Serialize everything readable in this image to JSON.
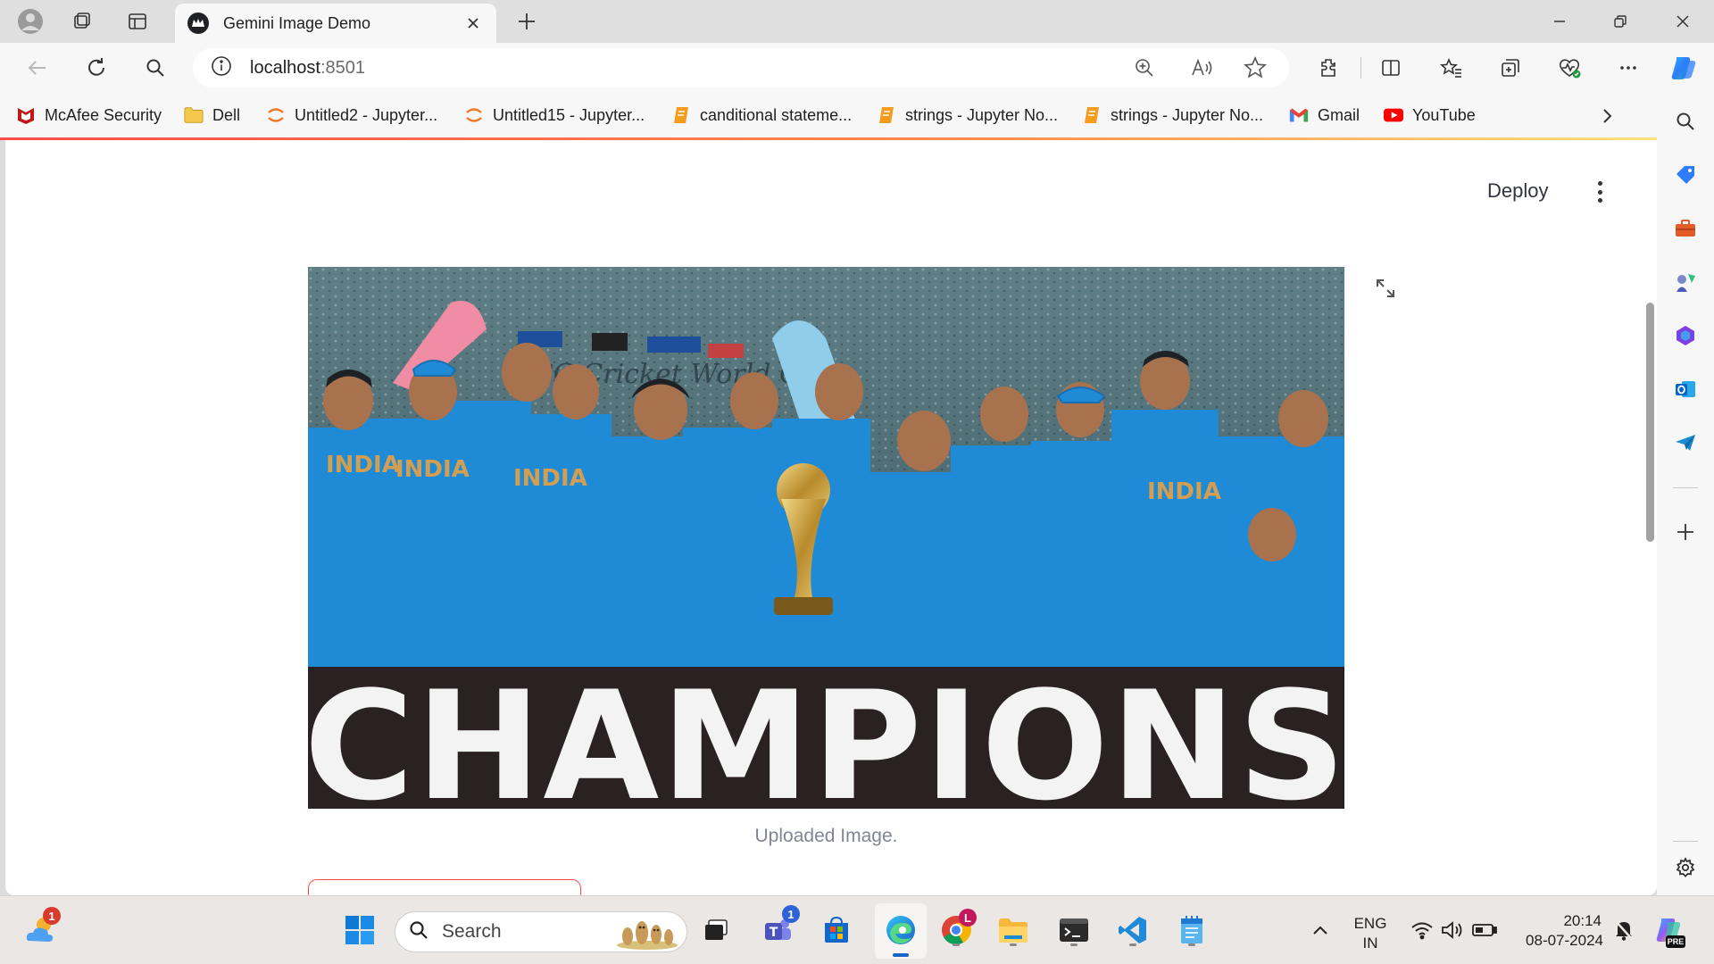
{
  "browser": {
    "tab": {
      "title": "Gemini Image Demo"
    },
    "address": {
      "host": "localhost",
      "port": ":8501"
    },
    "bookmarks": [
      {
        "label": "McAfee Security",
        "icon": "mcafee-icon"
      },
      {
        "label": "Dell",
        "icon": "folder-icon"
      },
      {
        "label": "Untitled2 - Jupyter...",
        "icon": "jupyter-icon"
      },
      {
        "label": "Untitled15 - Jupyter...",
        "icon": "jupyter-icon"
      },
      {
        "label": "canditional stateme...",
        "icon": "notebook-icon"
      },
      {
        "label": "strings - Jupyter No...",
        "icon": "notebook-icon"
      },
      {
        "label": "strings - Jupyter No...",
        "icon": "notebook-icon"
      },
      {
        "label": "Gmail",
        "icon": "gmail-icon"
      },
      {
        "label": "YouTube",
        "icon": "youtube-icon"
      }
    ]
  },
  "app": {
    "deploy_label": "Deploy",
    "image": {
      "banner_text": "CHAMPIONS",
      "caption": "Uploaded Image."
    }
  },
  "taskbar": {
    "search_label": "Search",
    "weather_badge": "1",
    "teams_badge": "1",
    "chrome_badge": "L",
    "language": {
      "line1": "ENG",
      "line2": "IN"
    },
    "clock": {
      "time": "20:14",
      "date": "08-07-2024"
    },
    "copilot_badge": "PRE"
  },
  "colors": {
    "accent": "#ff4b4b",
    "jersey": "#1f8ad6",
    "edge_blue": "#1a64c8"
  }
}
